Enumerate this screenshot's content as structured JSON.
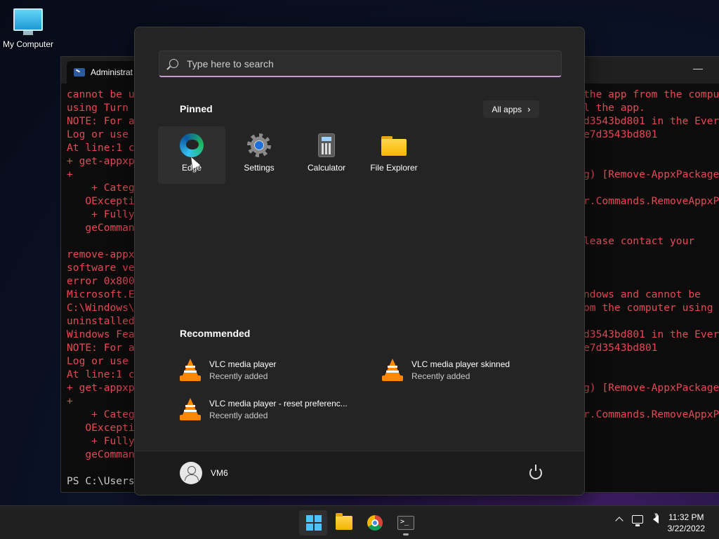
{
  "desktop": {
    "icon_label": "My Computer"
  },
  "terminal": {
    "tab_title": "Administrat",
    "left_lines": [
      "cannot be u",
      "using Turn ",
      "NOTE: For a",
      "Log or use ",
      "At line:1 c",
      "+ get-appxp",
      "+",
      "    + Categ",
      "   OExcepti",
      "    + Fully",
      "   geComman",
      "",
      "remove-appx",
      "software ve",
      "error 0x800",
      "Microsoft.E",
      "C:\\Windows\\",
      "uninstalled",
      "Windows Fea",
      "NOTE: For a",
      "Log or use ",
      "At line:1 c",
      "+ get-appxp",
      "+",
      "    + Categ",
      "   OExcepti",
      "    + Fully",
      "   geComman",
      ""
    ],
    "prompt": "PS C:\\Users",
    "right_lines": [
      "the app from the compu",
      "l the app.",
      "d3543bd801 in the Ever",
      "e7d3543bd801",
      "",
      "",
      "g) [Remove-AppxPackage",
      "",
      "r.Commands.RemoveAppxP",
      "",
      "",
      "lease contact your",
      "",
      "",
      "",
      "ndows and cannot be",
      "om the computer using",
      "",
      "d3543bd801 in the Ever",
      "e7d3543bd801",
      "",
      "",
      "g) [Remove-AppxPackage",
      "",
      "r.Commands.RemoveAppxP"
    ]
  },
  "start_menu": {
    "search_placeholder": "Type here to search",
    "pinned_title": "Pinned",
    "all_apps_label": "All apps",
    "pinned": [
      {
        "label": "Edge",
        "icon": "edge-icon"
      },
      {
        "label": "Settings",
        "icon": "settings-icon"
      },
      {
        "label": "Calculator",
        "icon": "calculator-icon"
      },
      {
        "label": "File Explorer",
        "icon": "folder-icon"
      }
    ],
    "recommended_title": "Recommended",
    "recommended": [
      {
        "name": "VLC media player",
        "sub": "Recently added"
      },
      {
        "name": "VLC media player skinned",
        "sub": "Recently added"
      },
      {
        "name": "VLC media player - reset preferenc...",
        "sub": "Recently added"
      }
    ],
    "user_name": "VM6"
  },
  "taskbar": {
    "time": "11:32 PM",
    "date": "3/22/2022"
  },
  "colors": {
    "terminal_error_text": "#e74856",
    "accent": "#4cc2ff",
    "menu_bg": "#242424"
  }
}
